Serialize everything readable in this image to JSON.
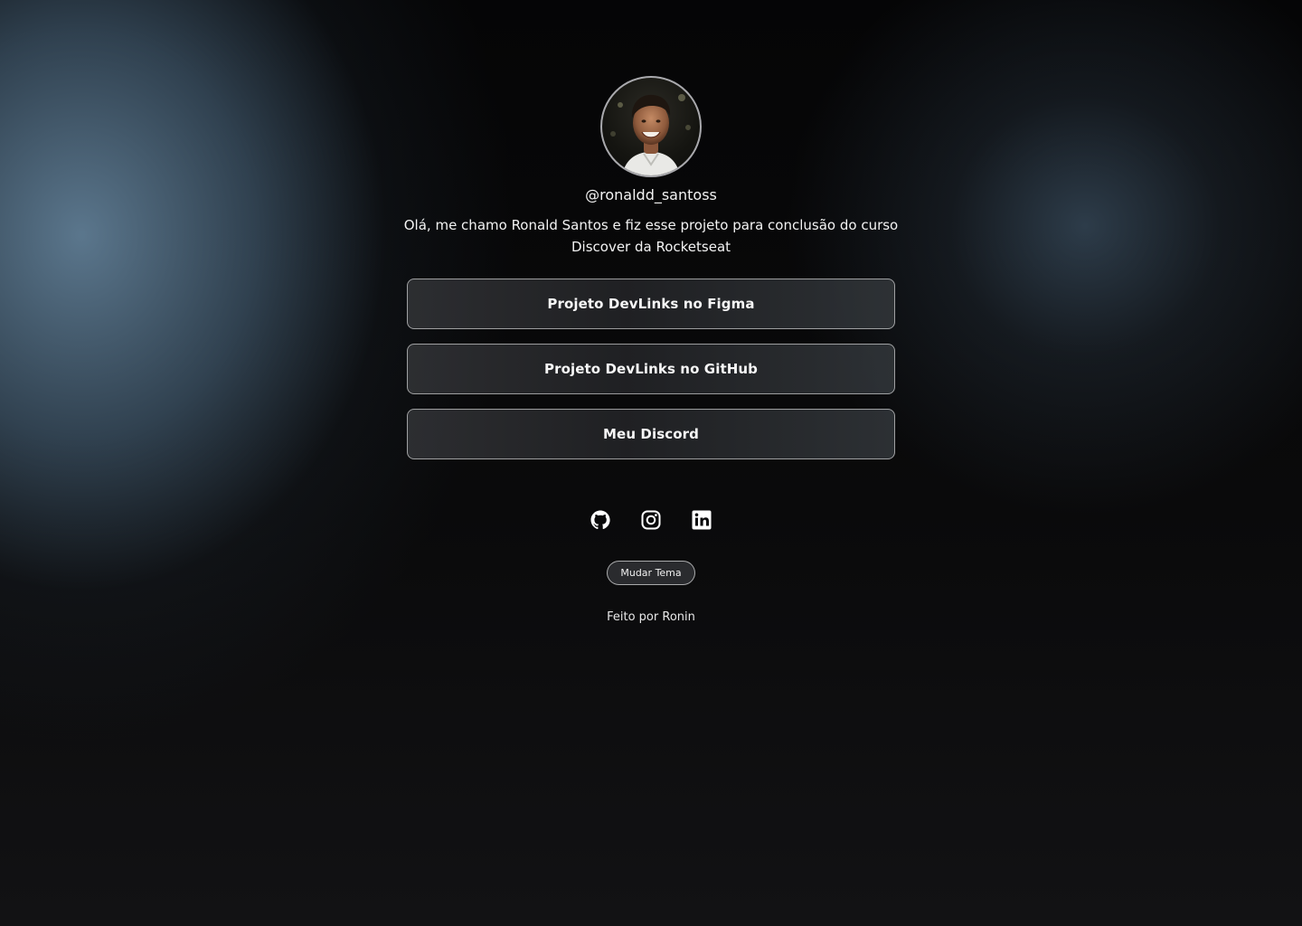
{
  "profile": {
    "username": "@ronaldd_santoss",
    "bio_line1": "Olá, me chamo Ronald Santos e fiz esse projeto para conclusão do curso",
    "bio_line2": "Discover da Rocketseat",
    "avatar_alt": "Ronald Santos"
  },
  "links": [
    {
      "label": "Projeto DevLinks no Figma"
    },
    {
      "label": "Projeto DevLinks no GitHub"
    },
    {
      "label": "Meu Discord"
    }
  ],
  "socials": [
    {
      "icon": "github-icon"
    },
    {
      "icon": "instagram-icon"
    },
    {
      "icon": "linkedin-icon"
    }
  ],
  "theme_toggle": {
    "label": "Mudar Tema"
  },
  "footer": {
    "text": "Feito por Ronin"
  },
  "colors": {
    "background": "#0a0a0b",
    "glow_left": "#628098",
    "glow_right": "#3a4e60",
    "button_bg": "#2a2b2e",
    "text": "#f5f5f5"
  }
}
